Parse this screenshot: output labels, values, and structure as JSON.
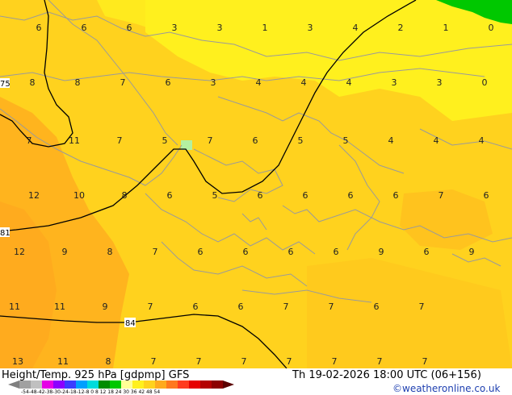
{
  "footer": {
    "product": "Height/Temp. 925 hPa [gdpmp] GFS",
    "valid": "Th 19-02-2026 18:00 UTC (06+156)",
    "credit": "©weatheronline.co.uk",
    "scale_ticks": "-54-48-42-38-30-24-18-12-8 0 8 12 18 24 30 36 42 48 54"
  },
  "colors": {
    "warm_yellow": "#ffd21e",
    "light_yellow": "#fff01e",
    "orange": "#ffaa1e",
    "green": "#00c800",
    "coast": "#9a9a9a",
    "isoline": "#000000"
  },
  "isolines": [
    "75",
    "81",
    "84"
  ],
  "temps": [
    [
      "6",
      "6",
      "6",
      "3",
      "3",
      "1",
      "3",
      "4",
      "2",
      "1",
      "0"
    ],
    [
      "8",
      "8",
      "7",
      "6",
      "3",
      "4",
      "4",
      "4",
      "3",
      "3",
      "0"
    ],
    [
      "7",
      "11",
      "7",
      "5",
      "7",
      "6",
      "5",
      "5",
      "4",
      "4",
      "4"
    ],
    [
      "12",
      "10",
      "8",
      "6",
      "5",
      "6",
      "6",
      "6",
      "6",
      "7",
      "6"
    ],
    [
      "12",
      "9",
      "8",
      "7",
      "6",
      "6",
      "6",
      "6",
      "9",
      "6",
      "9"
    ],
    [
      "11",
      "11",
      "9",
      "7",
      "6",
      "6",
      "7",
      "7",
      "6",
      "7"
    ],
    [
      "13",
      "11",
      "8",
      "7",
      "7",
      "7",
      "7",
      "7",
      "7",
      "7"
    ]
  ]
}
